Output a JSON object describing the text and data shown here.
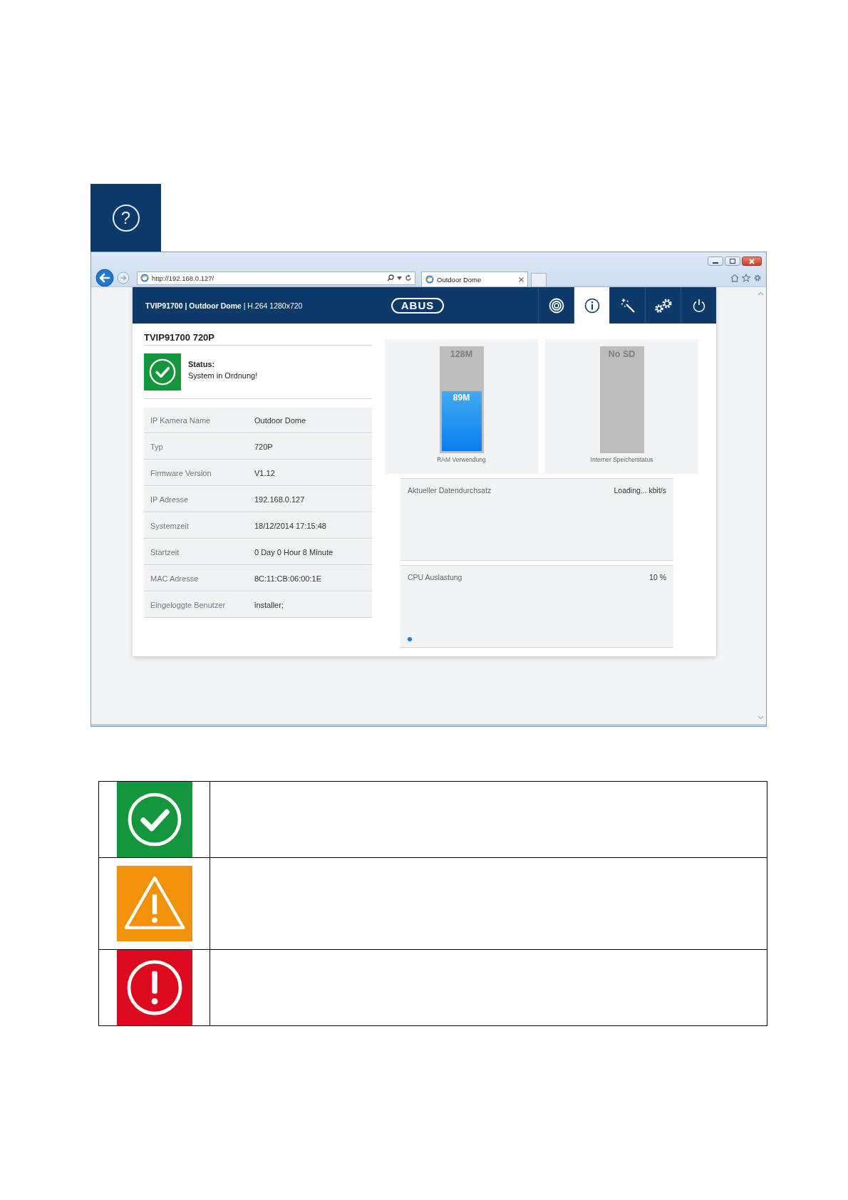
{
  "help_button": {
    "glyph": "?"
  },
  "browser": {
    "url": "http://192.168.0.127/",
    "tab_title": "Outdoor Dome"
  },
  "app": {
    "header_title": "**TVIP91700 | Outdoor Dome** | H.264 1280x720",
    "logo": "ABUS",
    "nav": [
      {
        "kind": "camera",
        "selected": false
      },
      {
        "kind": "info",
        "selected": true
      },
      {
        "kind": "wizard",
        "selected": false
      },
      {
        "kind": "settings",
        "selected": false
      },
      {
        "kind": "power",
        "selected": false
      }
    ]
  },
  "device_title": "TVIP91700 720P",
  "status": {
    "kind": "ok",
    "label": "Status:",
    "message": "System in Ordnung!"
  },
  "info_rows": [
    {
      "label": "IP Kamera Name",
      "value": "Outdoor Dome"
    },
    {
      "label": "Typ",
      "value": "720P"
    },
    {
      "label": "Firmware Version",
      "value": "V1.12"
    },
    {
      "label": "IP Adresse",
      "value": "192.168.0.127"
    },
    {
      "label": "Systemzeit",
      "value": "18/12/2014 17:15:48"
    },
    {
      "label": "Startzeit",
      "value": "0 Day 0 Hour 8 Minute"
    },
    {
      "label": "MAC Adresse",
      "value": "8C:11:CB:06:00:1E"
    },
    {
      "label": "Eingeloggte Benutzer",
      "value": "installer;"
    }
  ],
  "gauges": [
    {
      "total": "128M",
      "used": "89M",
      "level": 0.6,
      "caption": "RAM Verwendung"
    },
    {
      "total": "No SD",
      "caption": "Interner Speicherstatus"
    }
  ],
  "throughput": {
    "label": "Aktueller Datendurchsatz",
    "reading": "Loading... kbit/s"
  },
  "cpu": {
    "label": "CPU Auslastung",
    "reading": "10 %"
  },
  "legend": [
    {
      "kind": "ok"
    },
    {
      "kind": "warning"
    },
    {
      "kind": "error"
    }
  ]
}
